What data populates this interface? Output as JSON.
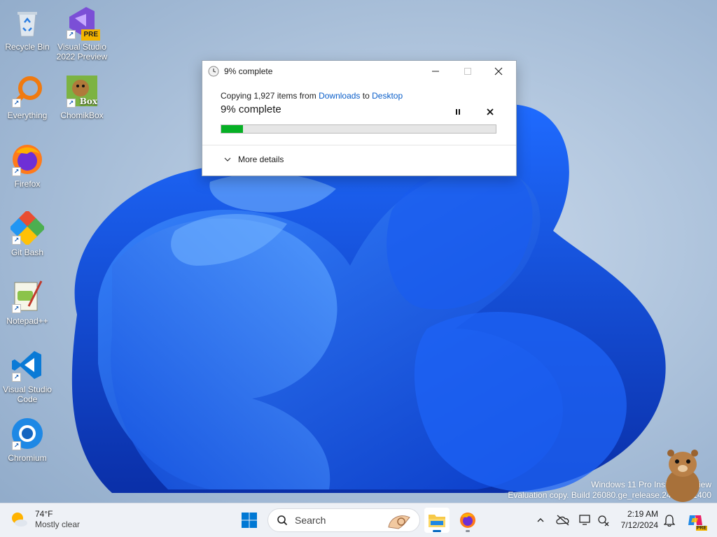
{
  "desktop": {
    "icons": [
      {
        "label": "Recycle Bin"
      },
      {
        "label": "Visual Studio 2022 Preview",
        "badge": "PRE"
      },
      {
        "label": "Everything"
      },
      {
        "label": "ChomikBox",
        "badge": "Box"
      },
      {
        "label": "Firefox"
      },
      {
        "label": "Git Bash"
      },
      {
        "label": "Notepad++"
      },
      {
        "label": "Visual Studio Code"
      },
      {
        "label": "Chromium"
      }
    ]
  },
  "copy_dialog": {
    "title": "9% complete",
    "info_prefix": "Copying 1,927 items from ",
    "source": "Downloads",
    "info_mid": " to ",
    "destination": "Desktop",
    "percent_text": "9% complete",
    "progress": 0.08,
    "more_details": "More details"
  },
  "watermark": {
    "line1": "Windows 11 Pro Insider Preview",
    "line2": "Evaluation copy. Build 26080.ge_release.240308-1400"
  },
  "taskbar": {
    "weather_temp": "74°F",
    "weather_desc": "Mostly clear",
    "search_placeholder": "Search",
    "time": "2:19 AM",
    "date": "7/12/2024",
    "copilot_badge": "PRE"
  },
  "colors": {
    "accent": "#0067c0",
    "progress": "#06b025",
    "link": "#0a5ec9"
  }
}
